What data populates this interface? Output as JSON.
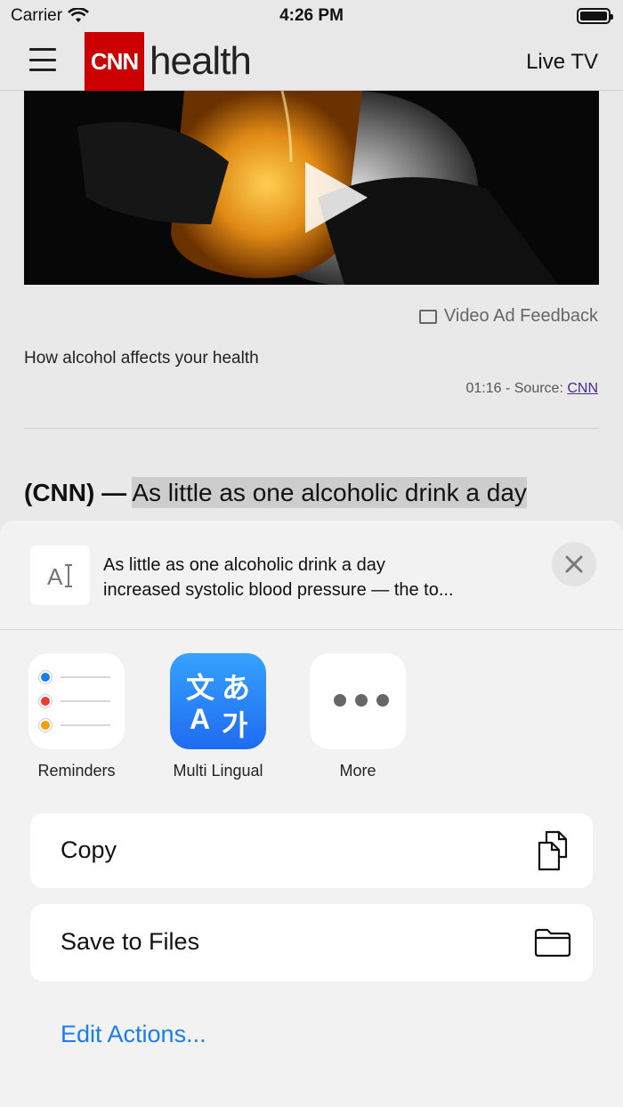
{
  "status": {
    "carrier": "Carrier",
    "time": "4:26 PM"
  },
  "header": {
    "logo_box": "CNN",
    "logo_word": "health",
    "live_tv": "Live TV"
  },
  "article": {
    "video_feedback": "Video Ad Feedback",
    "caption": "How alcohol affects your health",
    "meta_prefix": "01:16 - Source: ",
    "meta_source": "CNN",
    "lead_source": "(CNN) —",
    "lead_selected": "As little as one alcoholic drink a day"
  },
  "sheet": {
    "preview_line1": "As little as one alcoholic drink a day",
    "preview_line2": "increased systolic blood pressure — the to...",
    "thumb_text": "AI",
    "apps": [
      {
        "label": "Reminders",
        "icon": "reminders-icon"
      },
      {
        "label": "Multi Lingual",
        "icon": "translate-icon",
        "glyphs": [
          "文",
          "あ",
          "A",
          "가"
        ]
      },
      {
        "label": "More",
        "icon": "more-icon"
      }
    ],
    "actions": [
      {
        "label": "Copy",
        "icon": "copy-icon"
      },
      {
        "label": "Save to Files",
        "icon": "folder-icon"
      }
    ],
    "edit_actions": "Edit Actions..."
  },
  "colors": {
    "cnn_red": "#cc0000",
    "link_blue": "#1a7cf0",
    "translate_blue": "#1f6bf0"
  }
}
